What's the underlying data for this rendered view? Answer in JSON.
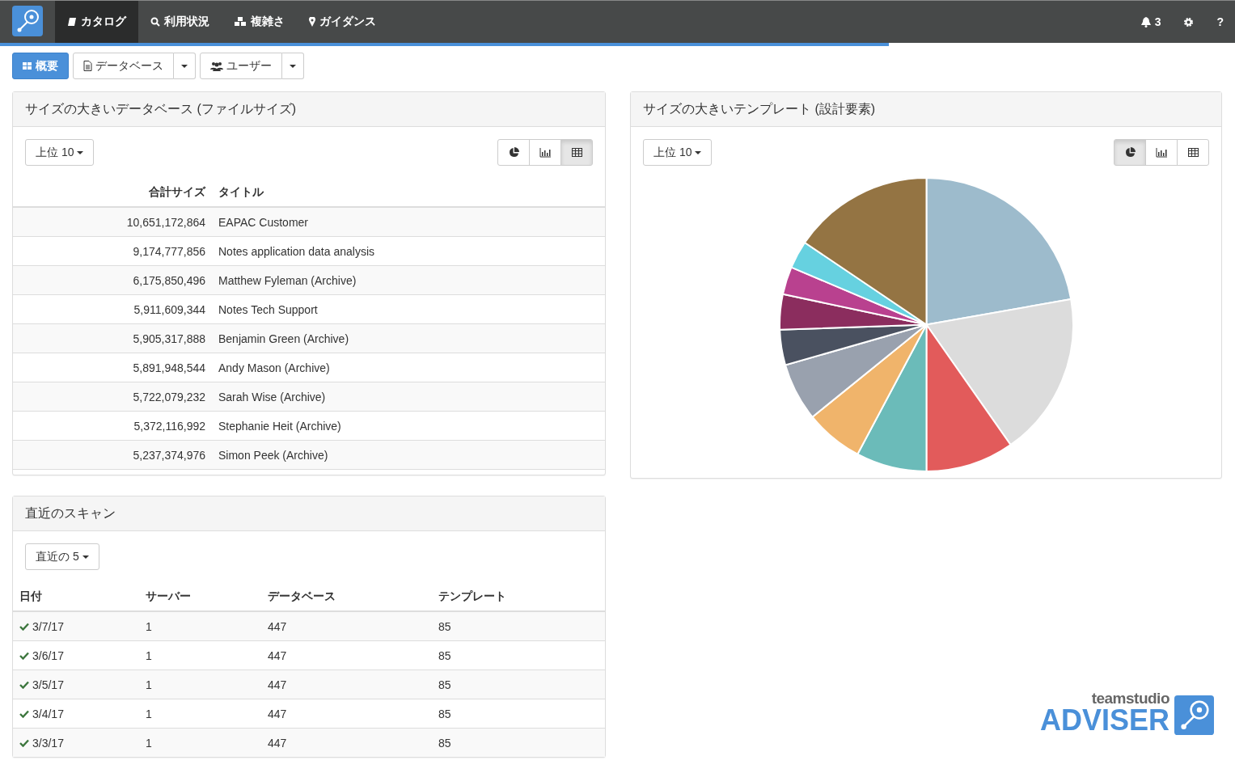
{
  "navbar": {
    "items": [
      {
        "label": "カタログ",
        "selected": true
      },
      {
        "label": "利用状況",
        "selected": false
      },
      {
        "label": "複雑さ",
        "selected": false
      },
      {
        "label": "ガイダンス",
        "selected": false
      }
    ],
    "notifications": "3",
    "help": "?"
  },
  "loading_bar": {
    "level": 0.72
  },
  "toolbar": [
    {
      "label": "概要",
      "kind": "single",
      "selected": true
    },
    {
      "label": "データベース",
      "kind": "split",
      "selected": false
    },
    {
      "label": "ユーザー",
      "kind": "split",
      "selected": false
    }
  ],
  "databases_panel": {
    "title": "サイズの大きいデータベース (ファイルサイズ)",
    "filter": "上位 10",
    "views": [
      {
        "kind": "pie",
        "selected": false
      },
      {
        "kind": "bar",
        "selected": false
      },
      {
        "kind": "table",
        "selected": true
      }
    ],
    "columns": [
      "合計サイズ",
      "タイトル"
    ],
    "rows": [
      [
        "10,651,172,864",
        "EAPAC Customer"
      ],
      [
        "9,174,777,856",
        "Notes application data analysis"
      ],
      [
        "6,175,850,496",
        "Matthew Fyleman (Archive)"
      ],
      [
        "5,911,609,344",
        "Notes Tech Support"
      ],
      [
        "5,905,317,888",
        "Benjamin Green (Archive)"
      ],
      [
        "5,891,948,544",
        "Andy Mason (Archive)"
      ],
      [
        "5,722,079,232",
        "Sarah Wise (Archive)"
      ],
      [
        "5,372,116,992",
        "Stephanie Heit (Archive)"
      ],
      [
        "5,237,374,976",
        "Simon Peek (Archive)"
      ]
    ]
  },
  "templates_panel": {
    "title": "サイズの大きいテンプレート (設計要素)",
    "filter": "上位 10",
    "views": [
      {
        "kind": "pie",
        "selected": true
      },
      {
        "kind": "bar",
        "selected": false
      },
      {
        "kind": "table",
        "selected": false
      }
    ]
  },
  "scans_panel": {
    "title": "直近のスキャン",
    "filter": "直近の 5",
    "columns": [
      "日付",
      "サーバー",
      "データベース",
      "テンプレート"
    ],
    "rows": [
      {
        "ok": true,
        "cells": [
          "3/7/17",
          "1",
          "447",
          "85"
        ]
      },
      {
        "ok": true,
        "cells": [
          "3/6/17",
          "1",
          "447",
          "85"
        ]
      },
      {
        "ok": true,
        "cells": [
          "3/5/17",
          "1",
          "447",
          "85"
        ]
      },
      {
        "ok": true,
        "cells": [
          "3/4/17",
          "1",
          "447",
          "85"
        ]
      },
      {
        "ok": true,
        "cells": [
          "3/3/17",
          "1",
          "447",
          "85"
        ]
      }
    ]
  },
  "logo": {
    "brand": "teamstudio",
    "product": "ADVISER"
  }
}
